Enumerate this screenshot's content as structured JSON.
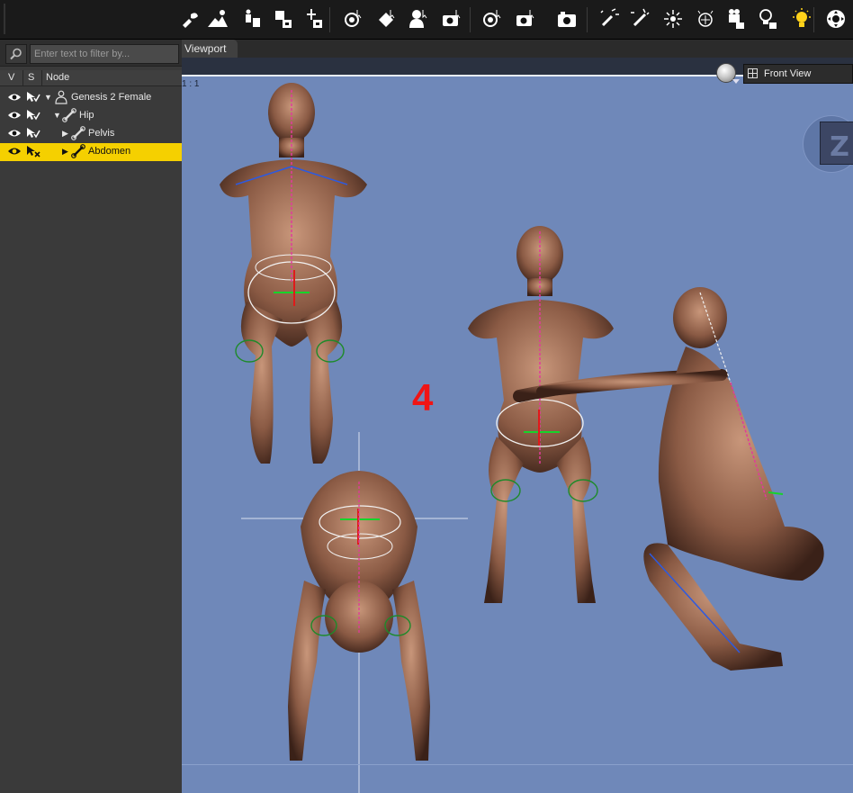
{
  "toolbar": {
    "icons": [
      "universal-tool-icon",
      "environment-icon",
      "figure-icon",
      "render-to-new-icon",
      "scene-identification-icon",
      "rotate-camera-icon",
      "paint-tool-icon",
      "person-select-icon",
      "camera-cube-icon",
      "orbit-camera-icon",
      "camera-select-icon",
      "camera-icon",
      "spotlight-icon",
      "distant-light-icon",
      "point-light-icon",
      "linear-light-icon",
      "video-camera-icon",
      "light-bulb-icon",
      "headlamp-icon",
      "navigation-icon"
    ]
  },
  "scene_pane": {
    "filter": {
      "placeholder": "Enter text to filter by...",
      "value": ""
    },
    "columns": {
      "visible": "V",
      "selectable": "S",
      "node": "Node"
    },
    "nodes": [
      {
        "label": "Genesis 2 Female",
        "depth": 0,
        "expanded": true,
        "icon": "figure-icon",
        "selected": false
      },
      {
        "label": "Hip",
        "depth": 1,
        "expanded": true,
        "icon": "bone-icon",
        "selected": false
      },
      {
        "label": "Pelvis",
        "depth": 2,
        "expanded": false,
        "icon": "bone-icon",
        "selected": false
      },
      {
        "label": "Abdomen",
        "depth": 2,
        "expanded": false,
        "icon": "bone-icon",
        "selected": true
      }
    ]
  },
  "viewport": {
    "tab_label": "Viewport",
    "view_name": "Front View",
    "ratio_label": "1 : 1",
    "cube_label": "Z",
    "annotation": "4",
    "colors": {
      "background": "#6f88b9",
      "selection": "#f5d000",
      "annotation": "#f01414"
    }
  }
}
